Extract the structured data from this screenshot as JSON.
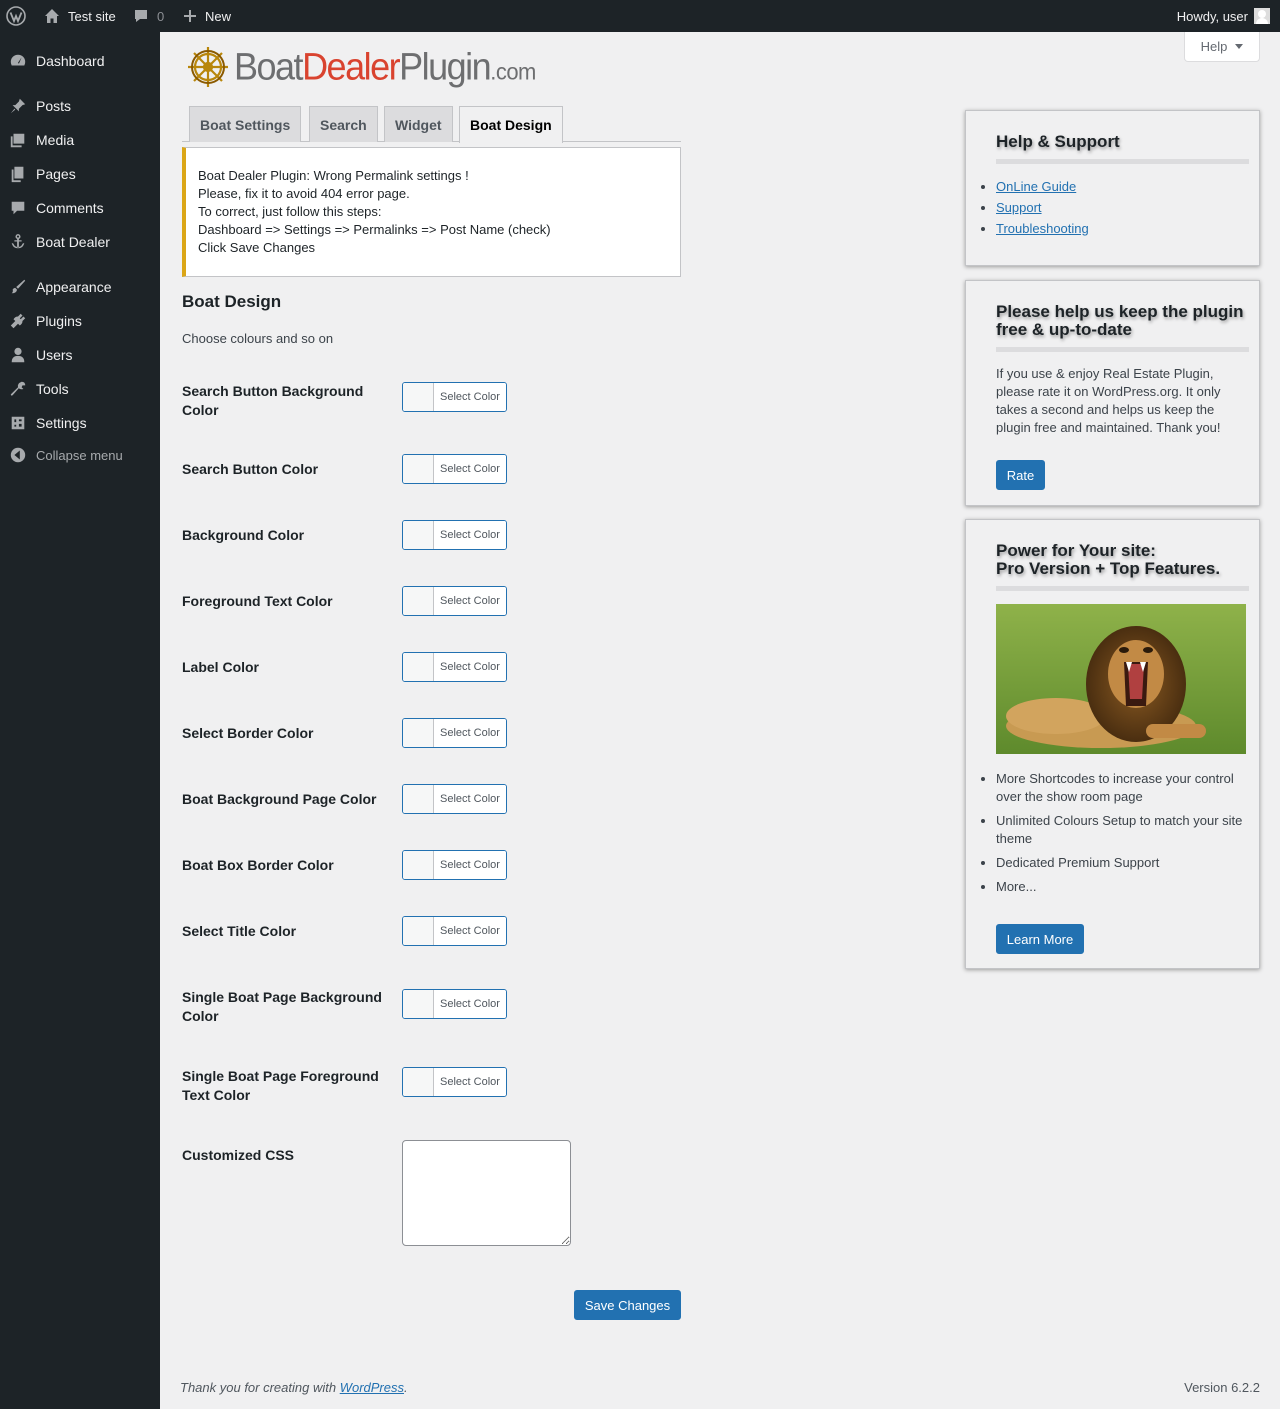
{
  "adminbar": {
    "site_name": "Test site",
    "comments_count": "0",
    "new_label": "New",
    "howdy": "Howdy, user"
  },
  "sidebar": {
    "items": [
      {
        "label": "Dashboard",
        "icon": "dashboard-icon"
      },
      {
        "label": "Posts",
        "icon": "pin-icon"
      },
      {
        "label": "Media",
        "icon": "media-icon"
      },
      {
        "label": "Pages",
        "icon": "pages-icon"
      },
      {
        "label": "Comments",
        "icon": "comment-icon"
      },
      {
        "label": "Boat Dealer",
        "icon": "anchor-icon"
      },
      {
        "label": "Appearance",
        "icon": "paintbrush-icon"
      },
      {
        "label": "Plugins",
        "icon": "plugin-icon"
      },
      {
        "label": "Users",
        "icon": "user-icon"
      },
      {
        "label": "Tools",
        "icon": "wrench-icon"
      },
      {
        "label": "Settings",
        "icon": "settings-icon"
      }
    ],
    "collapse_label": "Collapse menu"
  },
  "help_tab": {
    "label": "Help"
  },
  "logo": {
    "boat": "Boat",
    "dealer": "Dealer",
    "plugin": "Plugin",
    "com": ".com"
  },
  "tabs": [
    {
      "label": "Boat Settings",
      "active": false
    },
    {
      "label": "Search",
      "active": false
    },
    {
      "label": "Widget",
      "active": false
    },
    {
      "label": "Boat Design",
      "active": true
    }
  ],
  "notice": {
    "lines": [
      "Boat Dealer Plugin: Wrong Permalink settings !",
      "Please, fix it to avoid 404 error page.",
      "To correct, just follow this steps:",
      "Dashboard => Settings => Permalinks => Post Name (check)",
      "Click Save Changes"
    ]
  },
  "page": {
    "title": "Boat Design",
    "subtitle": "Choose colours and so on"
  },
  "fields": [
    {
      "label": "Search Button Background Color",
      "button": "Select Color"
    },
    {
      "label": "Search Button Color",
      "button": "Select Color"
    },
    {
      "label": "Background Color",
      "button": "Select Color"
    },
    {
      "label": "Foreground Text Color",
      "button": "Select Color"
    },
    {
      "label": "Label Color",
      "button": "Select Color"
    },
    {
      "label": "Select Border Color",
      "button": "Select Color"
    },
    {
      "label": "Boat Background Page Color",
      "button": "Select Color"
    },
    {
      "label": "Boat Box Border Color",
      "button": "Select Color"
    },
    {
      "label": "Select Title Color",
      "button": "Select Color"
    },
    {
      "label": "Single Boat Page Background Color",
      "button": "Select Color"
    },
    {
      "label": "Single Boat Page Foreground Text Color",
      "button": "Select Color"
    }
  ],
  "custom_css": {
    "label": "Customized CSS",
    "value": ""
  },
  "save_label": "Save Changes",
  "help_panel": {
    "title": "Help & Support",
    "links": [
      "OnLine Guide",
      "Support",
      "Troubleshooting"
    ]
  },
  "rate_panel": {
    "title": "Please help us keep the plugin free & up-to-date",
    "text": "If you use & enjoy Real Estate Plugin, please rate it on WordPress.org. It only takes a second and helps us keep the plugin free and maintained. Thank you!",
    "button": "Rate"
  },
  "pro_panel": {
    "title_line1": "Power for Your site:",
    "title_line2": "Pro Version + Top Features.",
    "features": [
      "More Shortcodes to increase your control over the show room page",
      "Unlimited Colours Setup to match your site theme",
      "Dedicated Premium Support",
      "More..."
    ],
    "button": "Learn More"
  },
  "footer": {
    "thanks_prefix": "Thank you for creating with ",
    "thanks_link": "WordPress",
    "thanks_suffix": ".",
    "version": "Version 6.2.2"
  },
  "colors": {
    "admin_dark": "#1d2327",
    "primary": "#2271b1",
    "notice_warning": "#dba617",
    "logo_red": "#d9432f",
    "logo_grey": "#6d6e70",
    "wheel_gold": "#b8860b"
  }
}
